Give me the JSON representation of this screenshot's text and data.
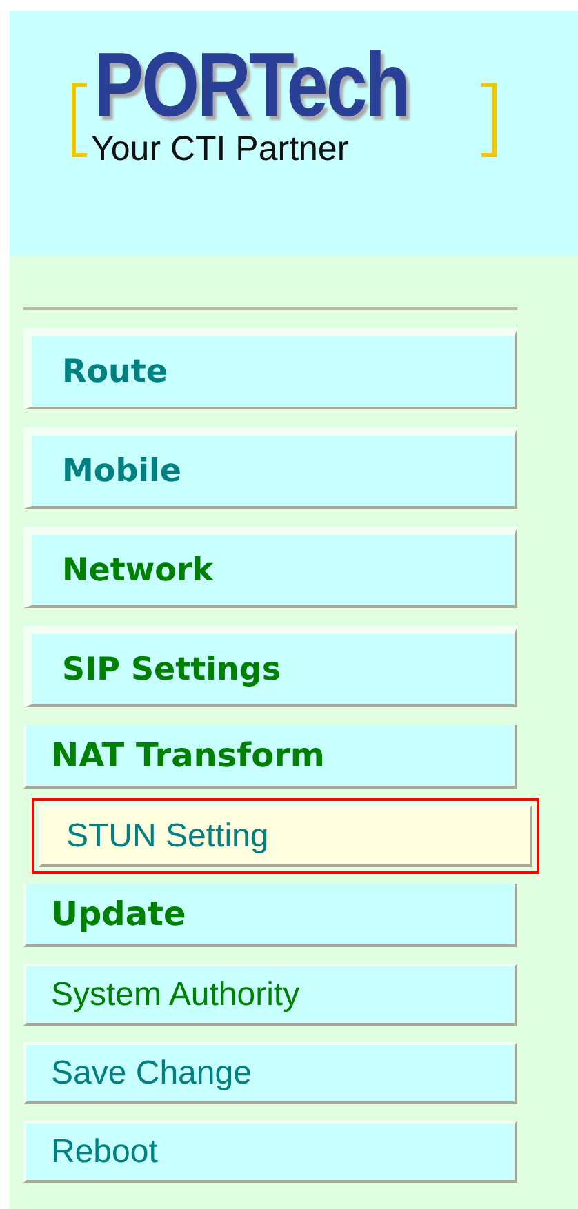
{
  "header": {
    "logo_title": "PORTech",
    "logo_tagline": "Your CTI Partner"
  },
  "menu": [
    {
      "label": "Route",
      "kind": "group",
      "color": "#008080",
      "selected": false
    },
    {
      "label": "Mobile",
      "kind": "group",
      "color": "#008080",
      "selected": false
    },
    {
      "label": "Network",
      "kind": "group",
      "color": "#008000",
      "selected": false
    },
    {
      "label": "SIP Settings",
      "kind": "group",
      "color": "#008000",
      "selected": false
    },
    {
      "label": "NAT Transform",
      "kind": "header",
      "color": "#008000",
      "selected": false
    },
    {
      "label": "STUN Setting",
      "kind": "link",
      "color": "#008080",
      "selected": true
    },
    {
      "label": "Update",
      "kind": "header",
      "color": "#008000",
      "selected": false
    },
    {
      "label": "System Authority",
      "kind": "link",
      "color": "#008000",
      "selected": false
    },
    {
      "label": "Save Change",
      "kind": "link",
      "color": "#008080",
      "selected": false
    },
    {
      "label": "Reboot",
      "kind": "link",
      "color": "#008080",
      "selected": false
    }
  ]
}
